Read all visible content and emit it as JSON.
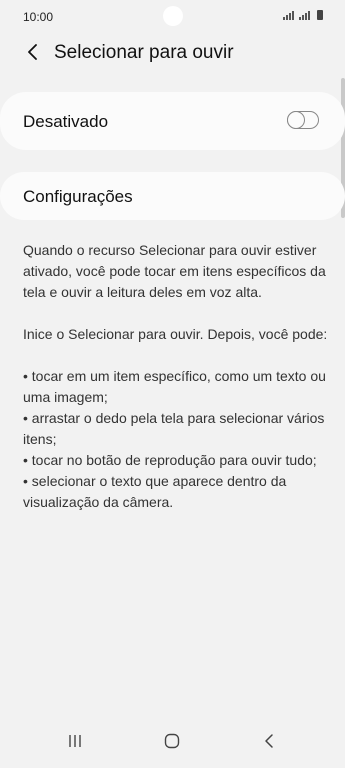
{
  "status_bar": {
    "time": "10:00"
  },
  "header": {
    "title": "Selecionar para ouvir",
    "back_icon": "chevron-left-icon"
  },
  "toggle_card": {
    "label": "Desativado",
    "enabled": false
  },
  "settings_card": {
    "label": "Configurações"
  },
  "description": {
    "intro": "Quando o recurso Selecionar para ouvir estiver ativado, você pode tocar em itens específicos da tela e ouvir a leitura deles em voz alta.",
    "start": "Inice o Selecionar para ouvir. Depois, você pode:",
    "bullets": [
      "• tocar em um item específico, como um texto ou uma imagem;",
      "• arrastar o dedo pela tela para selecionar vários itens;",
      "• tocar no botão de reprodução para ouvir tudo;",
      "• selecionar o texto que aparece dentro da visualização da câmera."
    ]
  },
  "nav_bar": {
    "recent_icon": "recent-apps-icon",
    "home_icon": "home-icon",
    "back_icon": "back-icon"
  },
  "colors": {
    "background": "#f2f2f2",
    "card": "#fbfbfb",
    "text_primary": "#111111",
    "text_secondary": "#333333",
    "switch_border": "#888888"
  }
}
